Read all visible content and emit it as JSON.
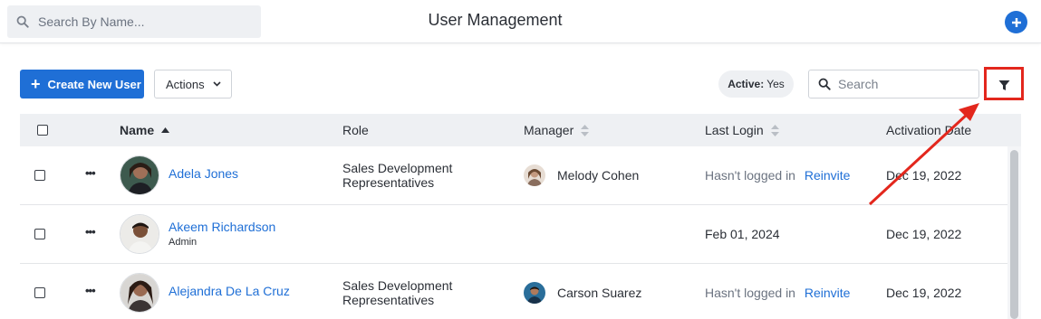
{
  "header": {
    "search_placeholder": "Search By Name...",
    "title": "User Management",
    "add_icon": "plus-icon"
  },
  "toolbar": {
    "create_label": "Create New User",
    "actions_label": "Actions",
    "active_filter_key": "Active:",
    "active_filter_value": "Yes",
    "search_placeholder": "Search",
    "filter_icon": "filter-icon"
  },
  "columns": {
    "name": "Name",
    "role": "Role",
    "manager": "Manager",
    "last_login": "Last Login",
    "activation_date": "Activation Date"
  },
  "rows": [
    {
      "name": "Adela Jones",
      "subrole": "",
      "role_line1": "Sales Development",
      "role_line2": "Representatives",
      "manager": "Melody Cohen",
      "last_login": "Hasn't logged in",
      "reinvite": "Reinvite",
      "activation_date": "Dec 19, 2022"
    },
    {
      "name": "Akeem Richardson",
      "subrole": "Admin",
      "role_line1": "",
      "role_line2": "",
      "manager": "",
      "last_login": "Feb 01, 2024",
      "reinvite": "",
      "activation_date": "Dec 19, 2022"
    },
    {
      "name": "Alejandra De La Cruz",
      "subrole": "",
      "role_line1": "Sales Development",
      "role_line2": "Representatives",
      "manager": "Carson Suarez",
      "last_login": "Hasn't logged in",
      "reinvite": "Reinvite",
      "activation_date": "Dec 19, 2022"
    }
  ],
  "colors": {
    "accent": "#1f6fd6",
    "highlight": "#e3271d"
  }
}
